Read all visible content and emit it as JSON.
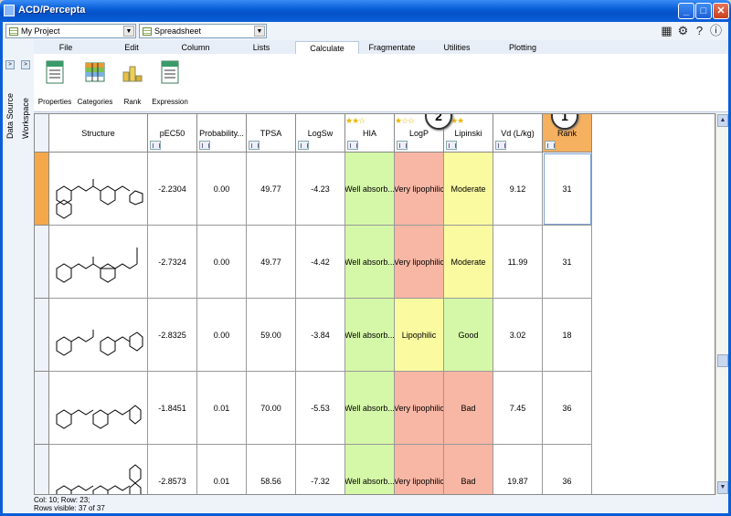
{
  "window": {
    "title": "ACD/Percepta"
  },
  "toolbar": {
    "project_combo": "My Project",
    "view_combo": "Spreadsheet"
  },
  "side_tabs": [
    "Data Source",
    "Workspace"
  ],
  "menu": [
    {
      "label": "File",
      "active": false
    },
    {
      "label": "Edit",
      "active": false
    },
    {
      "label": "Column",
      "active": false
    },
    {
      "label": "Lists",
      "active": false
    },
    {
      "label": "Calculate",
      "active": true
    },
    {
      "label": "Fragmentate",
      "active": false
    },
    {
      "label": "Utilities",
      "active": false
    },
    {
      "label": "Plotting",
      "active": false
    }
  ],
  "ribbon": [
    {
      "label": "Properties",
      "icon": "properties-icon"
    },
    {
      "label": "Categories",
      "icon": "categories-icon"
    },
    {
      "label": "Rank",
      "icon": "rank-icon"
    },
    {
      "label": "Expression",
      "icon": "expression-icon"
    }
  ],
  "columns": [
    {
      "label": "Structure"
    },
    {
      "label": "pEC50"
    },
    {
      "label": "Probability..."
    },
    {
      "label": "TPSA"
    },
    {
      "label": "LogSw"
    },
    {
      "label": "HIA",
      "stars": "★★☆"
    },
    {
      "label": "LogP",
      "stars": "★☆☆"
    },
    {
      "label": "Lipinski",
      "stars": "★★★"
    },
    {
      "label": "Vd (L/kg)"
    },
    {
      "label": "Rank"
    }
  ],
  "rows": [
    {
      "pEC50": "-2.2304",
      "prob": "0.00",
      "tpsa": "49.77",
      "logsw": "-4.23",
      "hia": "Well absorb...",
      "logp": "Very lipophilic",
      "lipinski": "Moderate",
      "vd": "9.12",
      "rank": "31"
    },
    {
      "pEC50": "-2.7324",
      "prob": "0.00",
      "tpsa": "49.77",
      "logsw": "-4.42",
      "hia": "Well absorb...",
      "logp": "Very lipophilic",
      "lipinski": "Moderate",
      "vd": "11.99",
      "rank": "31"
    },
    {
      "pEC50": "-2.8325",
      "prob": "0.00",
      "tpsa": "59.00",
      "logsw": "-3.84",
      "hia": "Well absorb...",
      "logp": "Lipophilic",
      "lipinski": "Good",
      "vd": "3.02",
      "rank": "18"
    },
    {
      "pEC50": "-1.8451",
      "prob": "0.01",
      "tpsa": "70.00",
      "logsw": "-5.53",
      "hia": "Well absorb...",
      "logp": "Very lipophilic",
      "lipinski": "Bad",
      "vd": "7.45",
      "rank": "36"
    },
    {
      "pEC50": "-2.8573",
      "prob": "0.01",
      "tpsa": "58.56",
      "logsw": "-7.32",
      "hia": "Well absorb...",
      "logp": "Very lipophilic",
      "lipinski": "Bad",
      "vd": "19.87",
      "rank": "36"
    }
  ],
  "colors": {
    "good": "#d5f8a8",
    "moderate": "#fafaa0",
    "bad": "#f8b6a4",
    "rank_header": "#f5b060"
  },
  "callouts": [
    "1",
    "2"
  ],
  "status": {
    "line1": "Col: 10; Row: 23;",
    "line2": "Rows visible: 37 of 37"
  }
}
